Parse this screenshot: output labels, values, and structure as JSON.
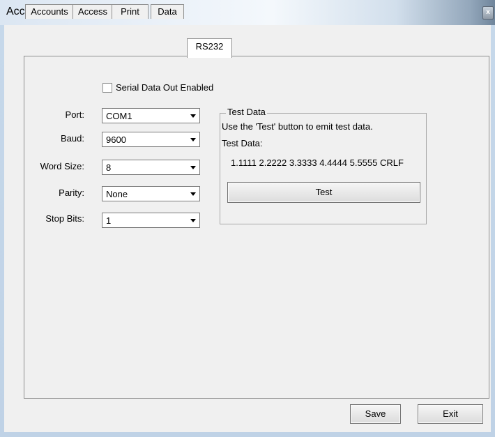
{
  "window": {
    "title": "Account Manager",
    "close_glyph": "x"
  },
  "tabs": [
    {
      "label": "Accounts"
    },
    {
      "label": "Access"
    },
    {
      "label": "Print"
    },
    {
      "label": "Data"
    },
    {
      "label": "RS232",
      "active": true
    }
  ],
  "serial": {
    "enabled_label": "Serial Data Out Enabled",
    "enabled": false
  },
  "fields": {
    "port": {
      "label": "Port:",
      "value": "COM1"
    },
    "baud": {
      "label": "Baud:",
      "value": "9600"
    },
    "word_size": {
      "label": "Word Size:",
      "value": "8"
    },
    "parity": {
      "label": "Parity:",
      "value": "None"
    },
    "stop_bits": {
      "label": "Stop Bits:",
      "value": "1"
    }
  },
  "test_group": {
    "legend": "Test Data",
    "instructions": "Use the 'Test' button to emit test data.",
    "data_label": "Test Data:",
    "data_value": "1.1111 2.2222 3.3333 4.4444 5.5555 CRLF",
    "test_button": "Test"
  },
  "footer": {
    "save_label": "Save",
    "exit_label": "Exit"
  }
}
